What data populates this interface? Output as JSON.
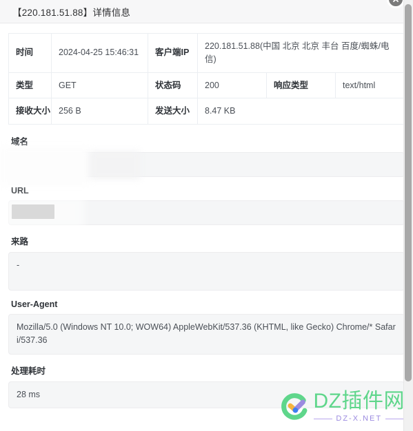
{
  "window": {
    "title": "【220.181.51.88】详情信息",
    "close_label": "×"
  },
  "info_table": {
    "rows": [
      [
        {
          "type": "key",
          "text": "时间"
        },
        {
          "type": "value",
          "text": "2024-04-25 15:46:31"
        },
        {
          "type": "key",
          "text": "客户端IP"
        },
        {
          "type": "value",
          "text": "220.181.51.88(中国 北京 北京 丰台 百度/蜘蛛/电信)"
        }
      ],
      [
        {
          "type": "key",
          "text": "类型"
        },
        {
          "type": "value",
          "text": "GET"
        },
        {
          "type": "key",
          "text": "状态码"
        },
        {
          "type": "value",
          "text": "200"
        },
        {
          "type": "key",
          "text": "响应类型"
        },
        {
          "type": "value",
          "text": "text/html"
        }
      ],
      [
        {
          "type": "key",
          "text": "接收大小"
        },
        {
          "type": "value",
          "text": "256 B"
        },
        {
          "type": "key",
          "text": "发送大小"
        },
        {
          "type": "value",
          "text": "8.47 KB"
        }
      ]
    ],
    "cells": {
      "time_label": "时间",
      "time_value": "2024-04-25 15:46:31",
      "client_ip_label": "客户端IP",
      "client_ip_value": "220.181.51.88(中国 北京 北京 丰台 百度/蜘蛛/电信)",
      "method_label": "类型",
      "method_value": "GET",
      "status_label": "状态码",
      "status_value": "200",
      "content_type_label": "响应类型",
      "content_type_value": "text/html",
      "recv_label": "接收大小",
      "recv_value": "256 B",
      "send_label": "发送大小",
      "send_value": "8.47 KB"
    }
  },
  "fields": {
    "domain": {
      "label": "域名",
      "value": ""
    },
    "url": {
      "label": "URL",
      "value": ""
    },
    "referer": {
      "label": "来路",
      "value": "-"
    },
    "user_agent": {
      "label": "User-Agent",
      "value": "Mozilla/5.0 (Windows NT 10.0; WOW64) AppleWebKit/537.36 (KHTML, like Gecko) Chrome/* Safari/537.36"
    },
    "duration": {
      "label": "处理耗时",
      "value": "28 ms"
    }
  },
  "watermark": {
    "name": "DZ插件网",
    "subtitle": "DZ-X.NET",
    "colors": {
      "green": "#5fd68b",
      "purple": "#9b8ae0",
      "orange": "#f5b43f",
      "blue": "#3d7ff0"
    }
  }
}
